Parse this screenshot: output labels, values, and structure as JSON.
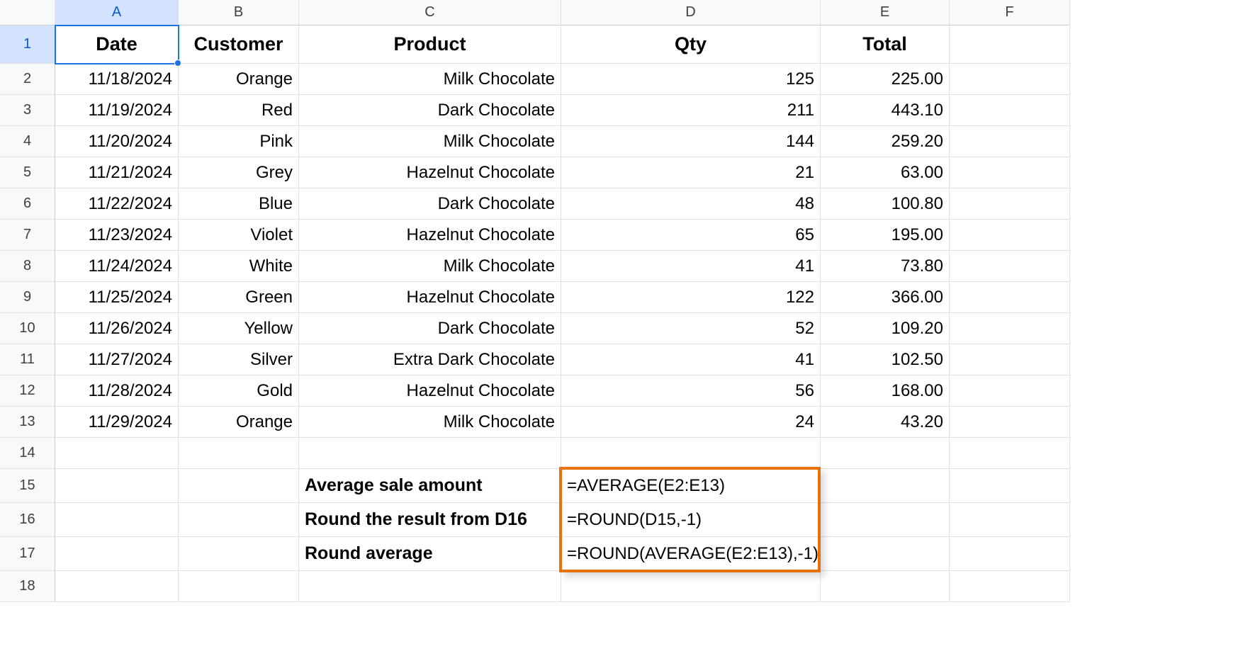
{
  "columns": [
    "A",
    "B",
    "C",
    "D",
    "E",
    "F"
  ],
  "rowCount": 18,
  "selectedCell": "A1",
  "headers": {
    "A": "Date",
    "B": "Customer",
    "C": "Product",
    "D": "Qty",
    "E": "Total"
  },
  "data": [
    {
      "date": "11/18/2024",
      "customer": "Orange",
      "product": "Milk Chocolate",
      "qty": "125",
      "total": "225.00"
    },
    {
      "date": "11/19/2024",
      "customer": "Red",
      "product": "Dark Chocolate",
      "qty": "211",
      "total": "443.10"
    },
    {
      "date": "11/20/2024",
      "customer": "Pink",
      "product": "Milk Chocolate",
      "qty": "144",
      "total": "259.20"
    },
    {
      "date": "11/21/2024",
      "customer": "Grey",
      "product": "Hazelnut Chocolate",
      "qty": "21",
      "total": "63.00"
    },
    {
      "date": "11/22/2024",
      "customer": "Blue",
      "product": "Dark Chocolate",
      "qty": "48",
      "total": "100.80"
    },
    {
      "date": "11/23/2024",
      "customer": "Violet",
      "product": "Hazelnut Chocolate",
      "qty": "65",
      "total": "195.00"
    },
    {
      "date": "11/24/2024",
      "customer": "White",
      "product": "Milk Chocolate",
      "qty": "41",
      "total": "73.80"
    },
    {
      "date": "11/25/2024",
      "customer": "Green",
      "product": "Hazelnut Chocolate",
      "qty": "122",
      "total": "366.00"
    },
    {
      "date": "11/26/2024",
      "customer": "Yellow",
      "product": "Dark Chocolate",
      "qty": "52",
      "total": "109.20"
    },
    {
      "date": "11/27/2024",
      "customer": "Silver",
      "product": "Extra Dark Chocolate",
      "qty": "41",
      "total": "102.50"
    },
    {
      "date": "11/28/2024",
      "customer": "Gold",
      "product": "Hazelnut Chocolate",
      "qty": "56",
      "total": "168.00"
    },
    {
      "date": "11/29/2024",
      "customer": "Orange",
      "product": "Milk Chocolate",
      "qty": "24",
      "total": "43.20"
    }
  ],
  "summary": [
    {
      "label": "Average sale amount",
      "formula": "=AVERAGE(E2:E13)"
    },
    {
      "label": "Round the result from D16",
      "formula": "=ROUND(D15,-1)"
    },
    {
      "label": "Round average",
      "formula": "=ROUND(AVERAGE(E2:E13),-1)"
    }
  ],
  "highlight": {
    "colStart": "D",
    "rowStart": 15,
    "rowEnd": 17
  }
}
